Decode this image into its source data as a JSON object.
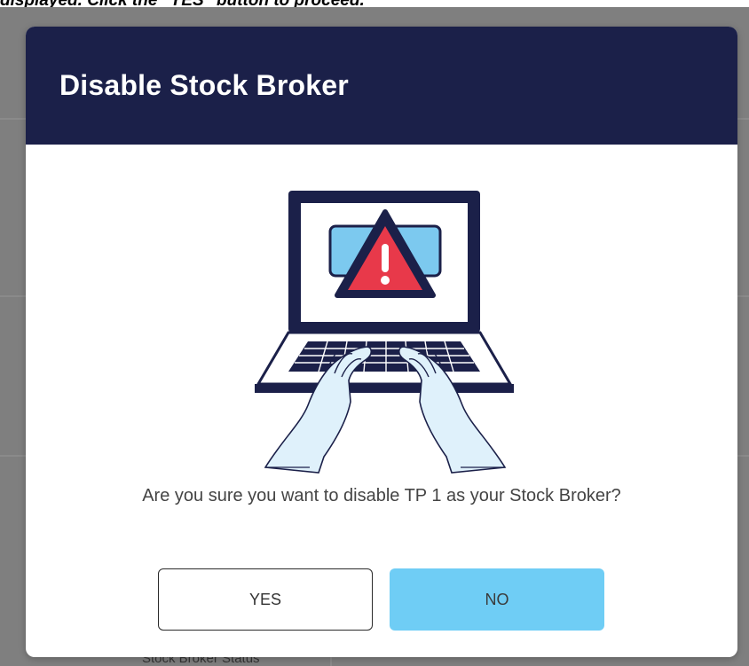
{
  "page": {
    "instruction": "displayed. Click the \"YES\" button to proceed."
  },
  "background": {
    "partial_label": "Stock Broker Status"
  },
  "modal": {
    "title": "Disable Stock Broker",
    "message": "Are you sure you want to disable TP 1 as your Stock Broker?",
    "illustration_icon": "laptop-warning-icon",
    "yes_label": "YES",
    "no_label": "NO"
  },
  "colors": {
    "header_bg": "#1b2049",
    "no_button_bg": "#6fcdf5",
    "warning_red": "#e8394a",
    "overlay": "#7f7f7f"
  }
}
